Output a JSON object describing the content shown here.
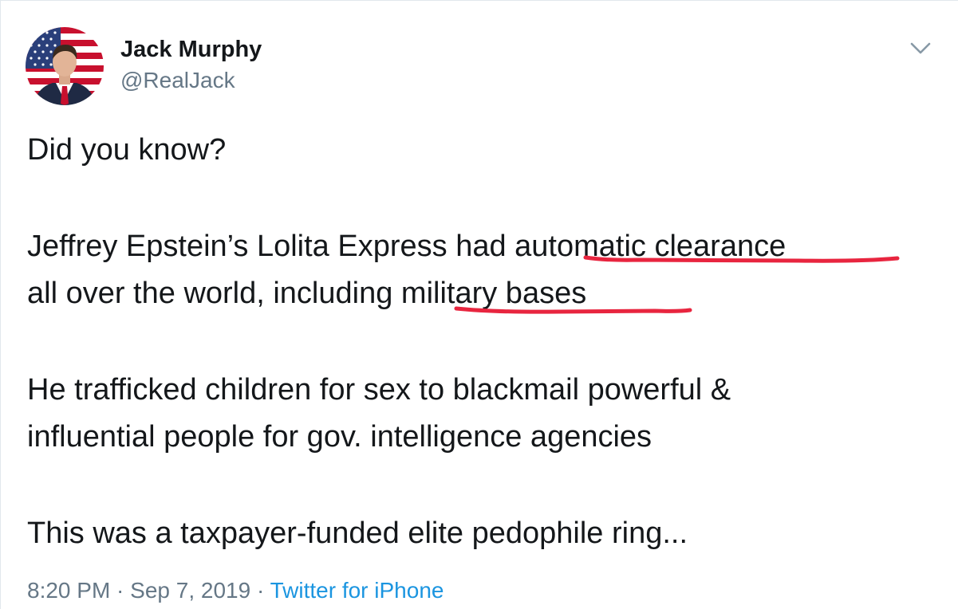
{
  "tweet": {
    "author": {
      "display_name": "Jack Murphy",
      "handle": "@RealJack"
    },
    "text": {
      "line1": "Did you know?",
      "para2_line1_a": "Jeffrey Epstein’s Lolita Express had ",
      "para2_line1_b": "automatic clearance",
      "para2_line2_a": "all over the world, including ",
      "para2_line2_b": "military bases",
      "para3_line1": "He trafficked children for sex to blackmail powerful &",
      "para3_line2": "influential people for gov. intelligence agencies",
      "para4_line1": "This was a taxpayer-funded elite pedophile ring..."
    },
    "meta": {
      "time": "8:20 PM",
      "separator1": " · ",
      "date": "Sep 7, 2019",
      "separator2": " · ",
      "source": "Twitter for iPhone"
    }
  },
  "icons": {
    "menu": "chevron-down-icon"
  },
  "colors": {
    "text": "#14171a",
    "secondary": "#657786",
    "link": "#1b95e0",
    "annotation": "#e8253f"
  }
}
